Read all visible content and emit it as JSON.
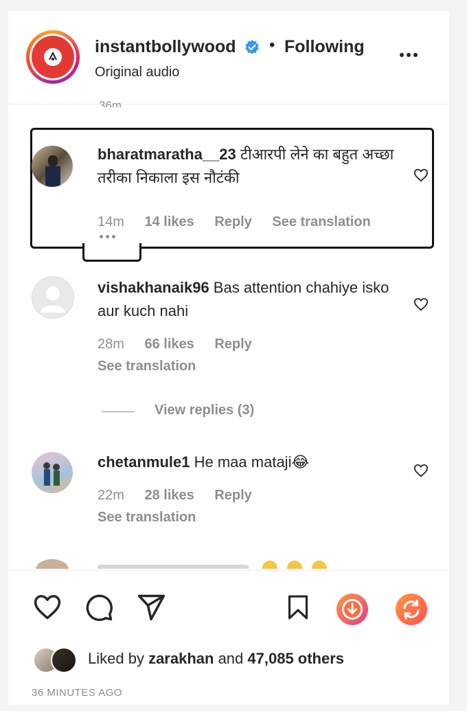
{
  "header": {
    "username": "instantbollywood",
    "separator": "•",
    "following_label": "Following",
    "audio_label": "Original audio",
    "cut_timestamp": "36m"
  },
  "comments": [
    {
      "username": "bharatmaratha__23",
      "text": "टीआरपी लेने का बहुत अच्छा तरीका निकाला इस नौटंकी",
      "time": "14m",
      "likes": "14 likes",
      "reply": "Reply",
      "translate": "See translation"
    },
    {
      "username": "vishakhanaik96",
      "text": "Bas attention chahiye isko aur kuch nahi",
      "time": "28m",
      "likes": "66 likes",
      "reply": "Reply",
      "translate": "See translation",
      "view_replies": "View replies (3)"
    },
    {
      "username": "chetanmule1",
      "text": "He maa mataji😂",
      "time": "22m",
      "likes": "28 likes",
      "reply": "Reply",
      "translate": "See translation"
    }
  ],
  "footer": {
    "liked_prefix": "Liked by ",
    "liked_user": "zarakhan",
    "liked_and": " and ",
    "liked_count": "47,085 others",
    "post_time": "36 MINUTES AGO"
  },
  "icons": {
    "like": "heart-icon",
    "comment": "comment-icon",
    "share": "share-icon",
    "save": "bookmark-icon",
    "download": "download-icon",
    "repost": "repost-icon"
  },
  "colors": {
    "verified": "#3897f0",
    "accent_orange": "#ff6b3d",
    "muted": "#8e8e8e"
  }
}
